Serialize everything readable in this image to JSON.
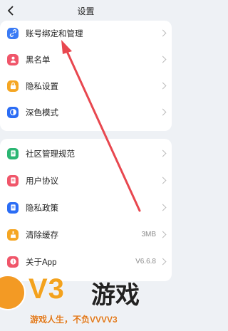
{
  "header": {
    "title": "设置"
  },
  "group1": [
    {
      "name": "account-binding",
      "label": "账号绑定和管理",
      "icon": "link-icon",
      "color": "#3a7bf5"
    },
    {
      "name": "blacklist",
      "label": "黑名单",
      "icon": "user-block-icon",
      "color": "#f0566a"
    },
    {
      "name": "privacy-settings",
      "label": "隐私设置",
      "icon": "lock-icon",
      "color": "#f5a623"
    },
    {
      "name": "dark-mode",
      "label": "深色模式",
      "icon": "contrast-icon",
      "color": "#2b6df5"
    }
  ],
  "group2": [
    {
      "name": "community-rules",
      "label": "社区管理规范",
      "icon": "doc-icon",
      "color": "#2bb673"
    },
    {
      "name": "user-agreement",
      "label": "用户协议",
      "icon": "doc-icon",
      "color": "#f0566a"
    },
    {
      "name": "privacy-policy",
      "label": "隐私政策",
      "icon": "doc-icon",
      "color": "#2b6df5"
    },
    {
      "name": "clear-cache",
      "label": "清除缓存",
      "icon": "broom-icon",
      "color": "#f5a623",
      "value": "3MB"
    },
    {
      "name": "about-app",
      "label": "关于App",
      "icon": "info-icon",
      "color": "#f0566a",
      "value": "V6.6.8"
    }
  ],
  "watermark": {
    "brand": "V3",
    "brand_cn": "游戏",
    "slogan": "游戏人生，不负VVVV3"
  },
  "colors": {
    "annotation_arrow": "#e8474f"
  }
}
